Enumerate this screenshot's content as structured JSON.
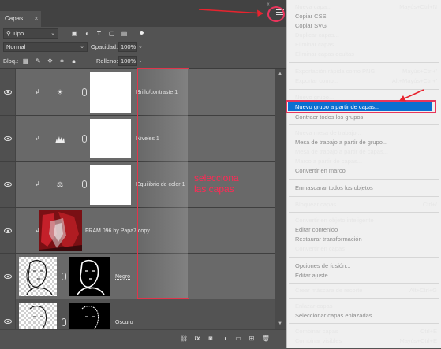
{
  "panel": {
    "tab_label": "Capas",
    "tab_close": "×",
    "collapse": "‹‹",
    "filter_kind": "Tipo",
    "blend_mode": "Normal",
    "opacity_label": "Opacidad:",
    "opacity_value": "100%",
    "lock_label": "Bloq.:",
    "fill_label": "Relleno:",
    "fill_value": "100%"
  },
  "layers": [
    {
      "name": "Brillo/contraste 1",
      "type": "adjustment",
      "icon": "sun-icon",
      "glyph": "☀"
    },
    {
      "name": "Niveles 1",
      "type": "adjustment",
      "icon": "levels-icon",
      "glyph": "▟"
    },
    {
      "name": "Equilibrio de color 1",
      "type": "adjustment",
      "icon": "balance-icon",
      "glyph": "⚖"
    },
    {
      "name": "FRAM 096 by Papa7 copy",
      "type": "image"
    },
    {
      "name": "Negro",
      "type": "masked"
    },
    {
      "name": "Oscuro",
      "type": "masked"
    }
  ],
  "annotation": {
    "line1": "selecciona",
    "line2": "las capas",
    "color": "#ff2a55"
  },
  "menu": {
    "highlight_color": "#0a6fd1",
    "items": [
      {
        "label": "Nueva capa...",
        "shortcut": "Mayús+Ctrl+N",
        "disabled": false
      },
      {
        "label": "Copiar CSS",
        "shortcut": "",
        "disabled": true
      },
      {
        "label": "Copiar SVG",
        "shortcut": "",
        "disabled": true
      },
      {
        "label": "Duplicar capas...",
        "shortcut": "",
        "disabled": false
      },
      {
        "label": "Eliminar capas",
        "shortcut": "",
        "disabled": false
      },
      {
        "label": "Eliminar capas ocultas",
        "shortcut": "",
        "disabled": false
      },
      {
        "label": "Exportación rápida como PNG",
        "shortcut": "Mayús+Ctrl+'",
        "disabled": false
      },
      {
        "label": "Exportar como...",
        "shortcut": "Alt+Mayús+Ctrl+'",
        "disabled": false
      },
      {
        "label": "Nuevo grupo...",
        "shortcut": "",
        "disabled": false
      },
      {
        "label": "Nuevo grupo a partir de capas...",
        "shortcut": "",
        "disabled": false,
        "highlighted": true
      },
      {
        "label": "Contraer todos los grupos",
        "shortcut": "",
        "disabled": true
      },
      {
        "label": "Nueva mesa de trabajo...",
        "shortcut": "",
        "disabled": false
      },
      {
        "label": "Mesa de trabajo a partir de grupo...",
        "shortcut": "",
        "disabled": true
      },
      {
        "label": "Mesa de trabajo a partir de capas...",
        "shortcut": "",
        "disabled": false
      },
      {
        "label": "Marco a partir de capas...",
        "shortcut": "",
        "disabled": false
      },
      {
        "label": "Convertir en marco",
        "shortcut": "",
        "disabled": true
      },
      {
        "label": "Enmascarar todos los objetos",
        "shortcut": "",
        "disabled": true
      },
      {
        "label": "Bloquear capas...",
        "shortcut": "Ctrl+/",
        "disabled": false
      },
      {
        "label": "Convertir en objeto inteligente",
        "shortcut": "",
        "disabled": false
      },
      {
        "label": "Editar contenido",
        "shortcut": "",
        "disabled": true
      },
      {
        "label": "Restaurar transformación",
        "shortcut": "",
        "disabled": true
      },
      {
        "label": "Convertir en capas",
        "shortcut": "",
        "disabled": false
      },
      {
        "label": "Opciones de fusión...",
        "shortcut": "",
        "disabled": true
      },
      {
        "label": "Editar ajuste...",
        "shortcut": "",
        "disabled": true
      },
      {
        "label": "Crear máscara de recorte",
        "shortcut": "Alt+Ctrl+G",
        "disabled": false
      },
      {
        "label": "Enlazar capas",
        "shortcut": "",
        "disabled": false
      },
      {
        "label": "Seleccionar capas enlazadas",
        "shortcut": "",
        "disabled": true
      },
      {
        "label": "Combinar capas",
        "shortcut": "Ctrl+E",
        "disabled": false
      },
      {
        "label": "Combinar visibles",
        "shortcut": "Mayús+Ctrl+E",
        "disabled": false
      }
    ]
  }
}
